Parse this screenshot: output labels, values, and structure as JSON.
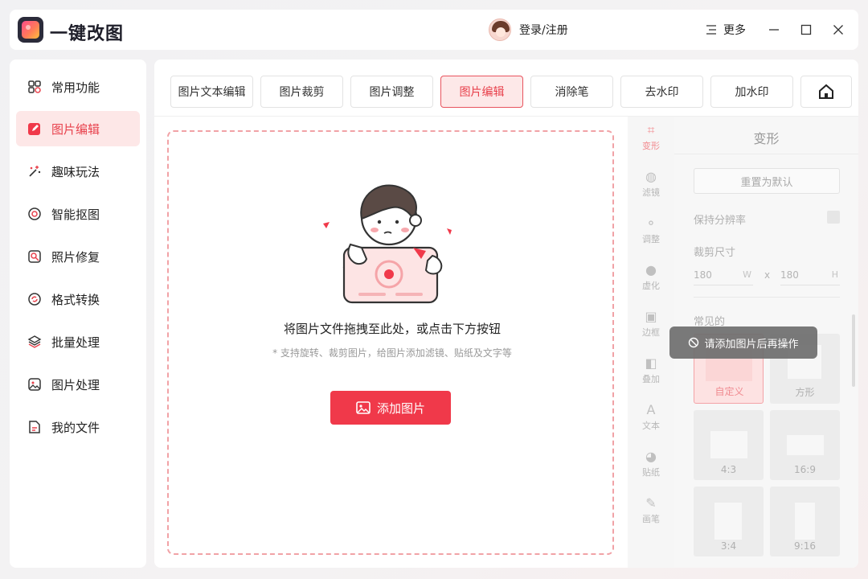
{
  "app": {
    "title": "一键改图"
  },
  "header": {
    "login": "登录/注册",
    "more": "更多"
  },
  "sidebar": {
    "items": [
      {
        "label": "常用功能",
        "icon": "grid-icon"
      },
      {
        "label": "图片编辑",
        "icon": "edit-icon",
        "active": true
      },
      {
        "label": "趣味玩法",
        "icon": "magic-wand-icon"
      },
      {
        "label": "智能抠图",
        "icon": "target-icon"
      },
      {
        "label": "照片修复",
        "icon": "photo-repair-icon"
      },
      {
        "label": "格式转换",
        "icon": "convert-icon"
      },
      {
        "label": "批量处理",
        "icon": "layers-icon"
      },
      {
        "label": "图片处理",
        "icon": "image-icon"
      },
      {
        "label": "我的文件",
        "icon": "document-icon"
      }
    ]
  },
  "tabs": [
    "图片文本编辑",
    "图片裁剪",
    "图片调整",
    "图片编辑",
    "消除笔",
    "去水印",
    "加水印"
  ],
  "active_tab": "图片编辑",
  "dropzone": {
    "main_text": "将图片文件拖拽至此处，或点击下方按钮",
    "sub_text": "* 支持旋转、裁剪图片，给图片添加滤镜、贴纸及文字等",
    "button": "添加图片"
  },
  "tools": [
    "变形",
    "滤镜",
    "调整",
    "虚化",
    "边框",
    "叠加",
    "文本",
    "贴纸",
    "画笔"
  ],
  "panel": {
    "title": "变形",
    "reset": "重置为默认",
    "keep_resolution": "保持分辨率",
    "crop_size": "裁剪尺寸",
    "width": "180",
    "width_unit": "W",
    "x": "x",
    "height": "180",
    "height_unit": "H",
    "common": "常见的",
    "presets": [
      "自定义",
      "方形",
      "4:3",
      "16:9",
      "3:4",
      "9:16"
    ]
  },
  "toast": "请添加图片后再操作",
  "colors": {
    "accent": "#f0394a",
    "active_bg": "#fde7e7"
  }
}
